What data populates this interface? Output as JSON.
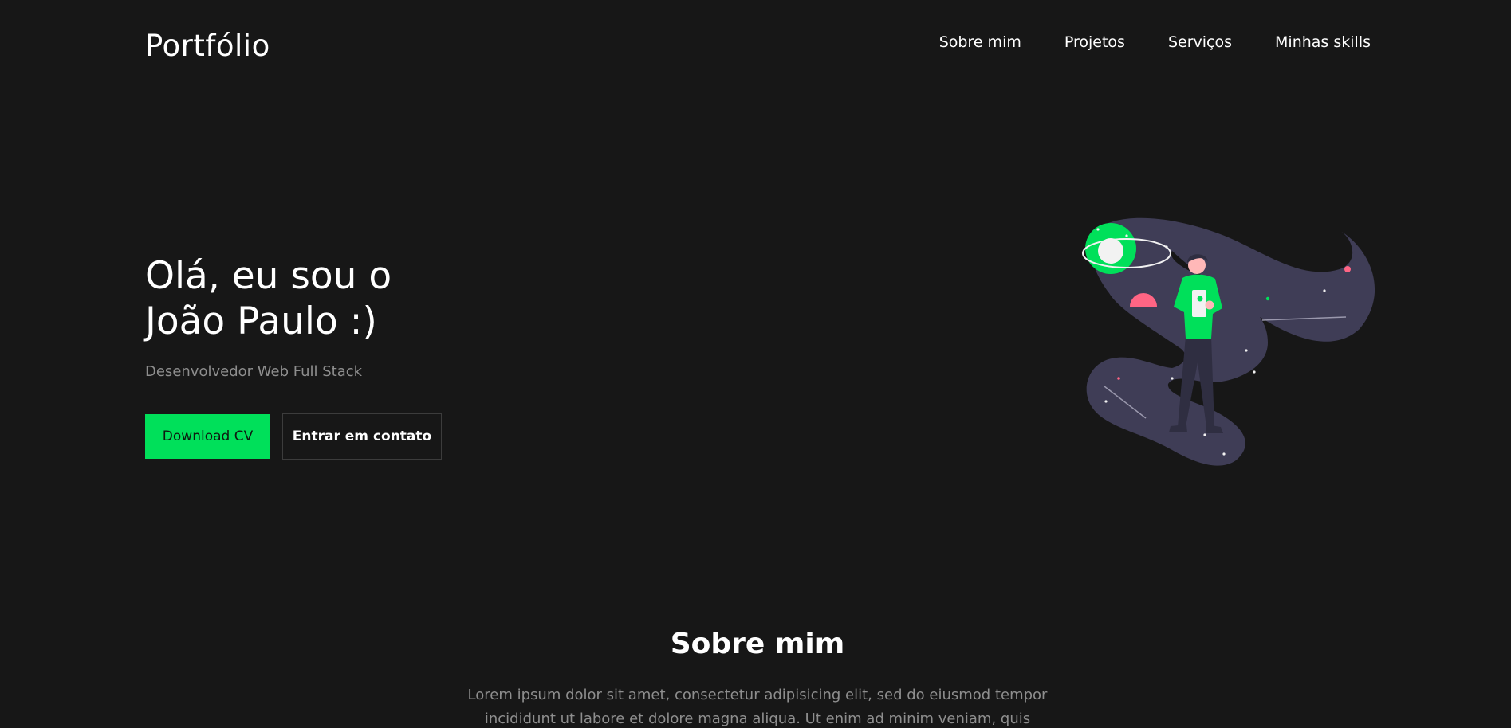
{
  "header": {
    "logo": "Portfólio",
    "nav": [
      {
        "label": "Sobre mim"
      },
      {
        "label": "Projetos"
      },
      {
        "label": "Serviços"
      },
      {
        "label": "Minhas skills"
      }
    ]
  },
  "hero": {
    "title_line1": "Olá, eu sou o",
    "title_line2": "João Paulo :)",
    "subtitle": "Desenvolvedor Web Full Stack",
    "primary_button": "Download CV",
    "secondary_button": "Entrar em contato",
    "illustration": "person-in-space-illustration"
  },
  "about": {
    "title": "Sobre mim",
    "text": "Lorem ipsum dolor sit amet, consectetur adipisicing elit, sed do eiusmod tempor incididunt ut labore et dolore magna aliqua. Ut enim ad minim veniam, quis nostrud"
  },
  "colors": {
    "background": "#171717",
    "accent": "#00e05a",
    "muted_text": "#8e8e8e",
    "illustration_purple": "#3f3d56",
    "illustration_pink": "#ff6584"
  }
}
